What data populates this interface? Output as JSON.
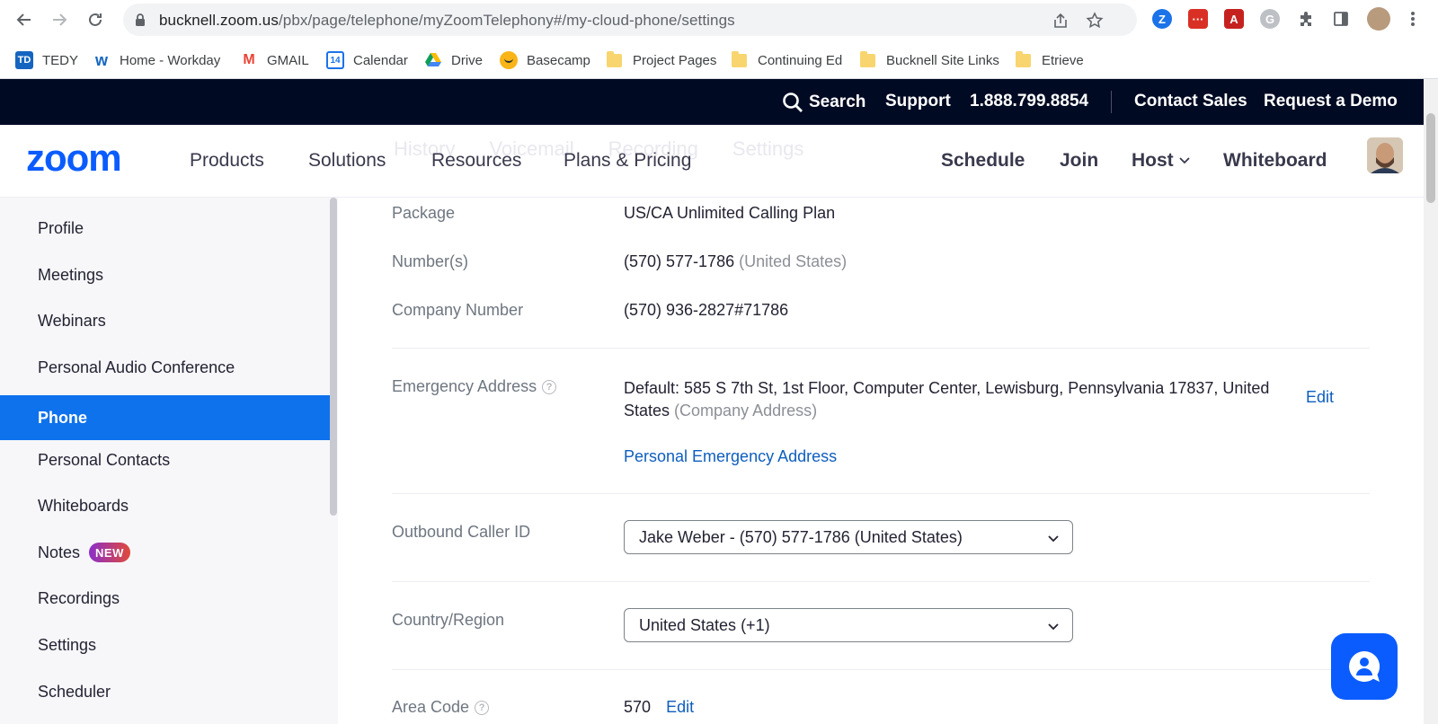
{
  "browser": {
    "url_host": "bucknell.zoom.us",
    "url_path": "/pbx/page/telephone/myZoomTelephony#/my-cloud-phone/settings",
    "bookmarks": [
      {
        "label": "TEDY",
        "fav": "TD"
      },
      {
        "label": "Home - Workday",
        "fav": "W"
      },
      {
        "label": "GMAIL",
        "fav": "M"
      },
      {
        "label": "Calendar",
        "fav": "14"
      },
      {
        "label": "Drive",
        "fav": "drive"
      },
      {
        "label": "Basecamp",
        "fav": "bc"
      },
      {
        "label": "Project Pages",
        "fav": "folder"
      },
      {
        "label": "Continuing Ed",
        "fav": "folder"
      },
      {
        "label": "Bucknell Site Links",
        "fav": "folder"
      },
      {
        "label": "Etrieve",
        "fav": "folder"
      }
    ]
  },
  "topbar": {
    "search": "Search",
    "support": "Support",
    "phone": "1.888.799.8854",
    "contact_sales": "Contact Sales",
    "request_demo": "Request a Demo"
  },
  "nav": {
    "logo": "zoom",
    "products": "Products",
    "solutions": "Solutions",
    "resources": "Resources",
    "plans": "Plans & Pricing",
    "schedule": "Schedule",
    "join": "Join",
    "host": "Host",
    "whiteboard": "Whiteboard",
    "ghost_tabs": [
      "History",
      "Voicemail",
      "Recording",
      "Settings"
    ]
  },
  "sidebar": {
    "items": [
      {
        "label": "Profile"
      },
      {
        "label": "Meetings"
      },
      {
        "label": "Webinars"
      },
      {
        "label": "Personal Audio Conference"
      },
      {
        "label": "Phone"
      },
      {
        "label": "Personal Contacts"
      },
      {
        "label": "Whiteboards"
      },
      {
        "label": "Notes",
        "badge": "NEW"
      },
      {
        "label": "Recordings"
      },
      {
        "label": "Settings"
      },
      {
        "label": "Scheduler"
      }
    ]
  },
  "settings": {
    "package_label": "Package",
    "package_value": "US/CA Unlimited Calling Plan",
    "numbers_label": "Number(s)",
    "numbers_value": "(570) 577-1786",
    "numbers_region": "(United States)",
    "company_number_label": "Company Number",
    "company_number_value": "(570) 936-2827#71786",
    "emergency_label": "Emergency Address",
    "emergency_line1": "Default: 585 S 7th St, 1st Floor, Computer Center, Lewisburg, Pennsylvania 17837, United",
    "emergency_line2": "States",
    "emergency_note": "(Company Address)",
    "emergency_edit": "Edit",
    "personal_emergency_link": "Personal Emergency Address",
    "caller_id_label": "Outbound Caller ID",
    "caller_id_value": "Jake Weber - (570) 577-1786 (United States)",
    "country_label": "Country/Region",
    "country_value": "United States (+1)",
    "area_code_label": "Area Code",
    "area_code_value": "570",
    "area_code_edit": "Edit"
  },
  "colors": {
    "accent": "#0e72ed",
    "topbar": "#000a23",
    "link": "#0e5ebe"
  }
}
